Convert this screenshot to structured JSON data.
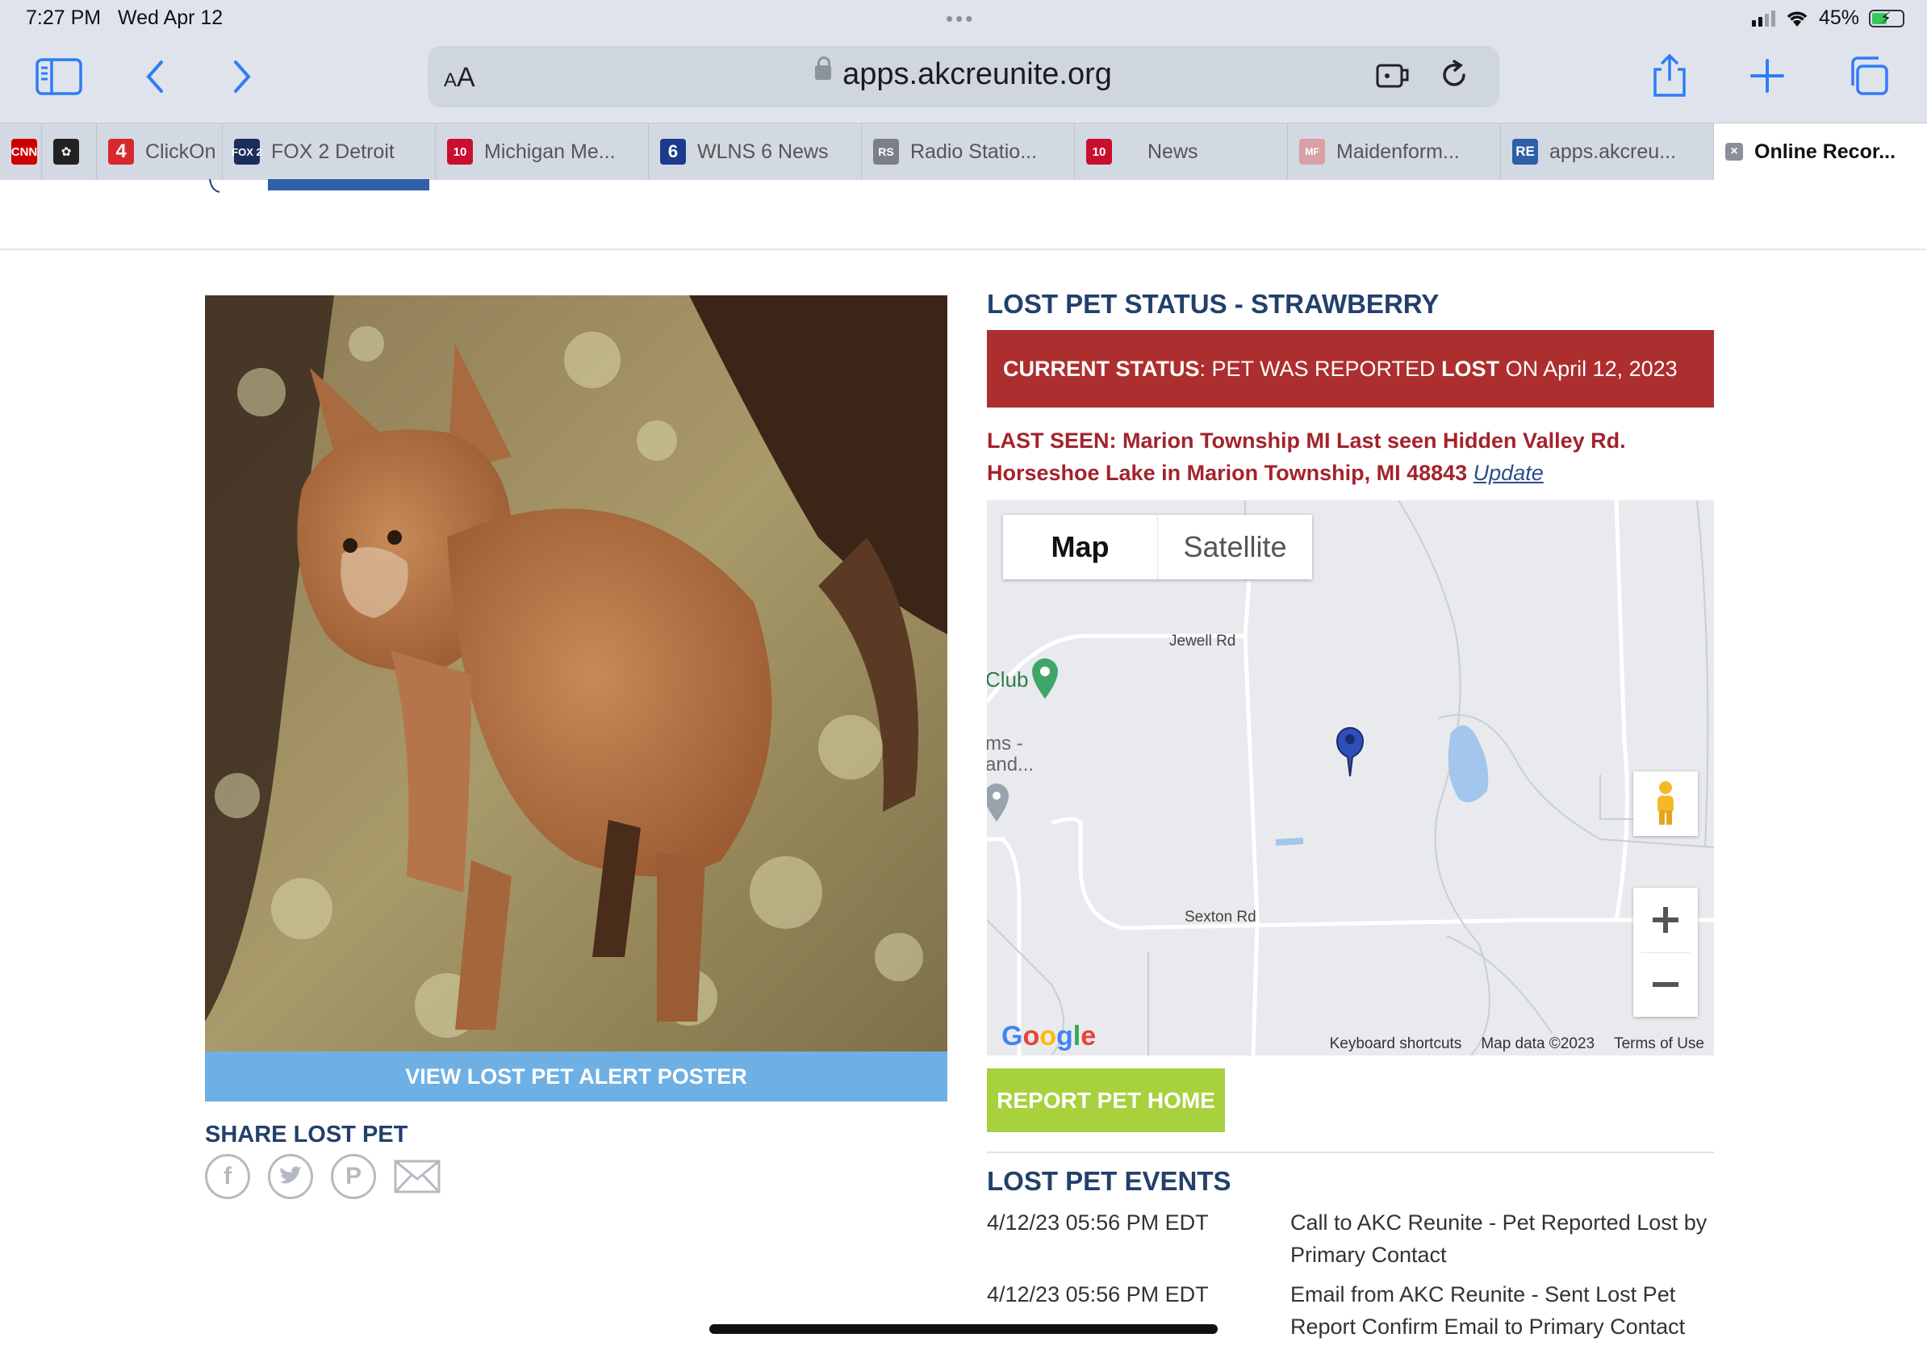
{
  "status_bar": {
    "time": "7:27 PM",
    "date": "Wed Apr 12",
    "battery": "45%"
  },
  "browser": {
    "aa_label_small": "A",
    "aa_label_big": "A",
    "url": "apps.akcreunite.org",
    "tabs": [
      {
        "label": "",
        "favicon_text": "CNN",
        "favicon_color": "#cc0000"
      },
      {
        "label": "",
        "favicon_text": "NBC",
        "favicon_color": "#222222"
      },
      {
        "label": "ClickOn",
        "favicon_text": "4",
        "favicon_color": "#d7282f"
      },
      {
        "label": "FOX 2 Detroit",
        "favicon_text": "FOX2",
        "favicon_color": "#1b2d5b"
      },
      {
        "label": "Michigan Me...",
        "favicon_text": "10",
        "favicon_color": "#c8102e"
      },
      {
        "label": "WLNS 6 News",
        "favicon_text": "6",
        "favicon_color": "#1d3b8c"
      },
      {
        "label": "Radio Statio...",
        "favicon_text": "RS",
        "favicon_color": "#7a7f88"
      },
      {
        "label": "News",
        "favicon_text": "10",
        "favicon_color": "#c8102e"
      },
      {
        "label": "Maidenform...",
        "favicon_text": "MF",
        "favicon_color": "#d9a0a6"
      },
      {
        "label": "apps.akcreu...",
        "favicon_text": "RE",
        "favicon_color": "#2e5fa8"
      },
      {
        "label": "Online Recor...",
        "favicon_text": "×",
        "favicon_color": "#8a8f98"
      }
    ]
  },
  "page": {
    "poster_button": "VIEW LOST PET ALERT POSTER",
    "share_title": "SHARE LOST PET",
    "share_icons": [
      "facebook-icon",
      "twitter-icon",
      "pinterest-icon",
      "mail-icon"
    ],
    "status_title": "LOST PET STATUS - STRAWBERRY",
    "current_status": {
      "label": "CURRENT STATUS",
      "text1": ": PET WAS REPORTED ",
      "lost": "LOST",
      "text2": " ON April 12, 2023"
    },
    "last_seen": {
      "text": "LAST SEEN: Marion Township MI Last seen Hidden Valley Rd. Horseshoe Lake in Marion Township, MI 48843",
      "update_link": "Update"
    },
    "map": {
      "tab_map": "Map",
      "tab_satellite": "Satellite",
      "labels": {
        "jewell": "Jewell Rd",
        "sexton": "Sexton Rd",
        "club": "Club",
        "ms1": "ms -",
        "ms2": "and..."
      },
      "footer": {
        "shortcuts": "Keyboard shortcuts",
        "data": "Map data ©2023",
        "terms": "Terms of Use"
      }
    },
    "report_button": "REPORT PET HOME",
    "events_title": "LOST PET EVENTS",
    "events": [
      {
        "date": "4/12/23 05:56 PM EDT",
        "text": "Call to AKC Reunite - Pet Reported Lost by Primary Contact"
      },
      {
        "date": "4/12/23 05:56 PM EDT",
        "text": "Email from AKC Reunite - Sent Lost Pet Report Confirm Email to Primary Contact"
      }
    ]
  },
  "colors": {
    "navy": "#22406b",
    "status_red": "#ad2e2e",
    "poster_blue": "#6eb0e4",
    "report_green": "#a7d13d",
    "ios_blue": "#2f7cf6"
  }
}
